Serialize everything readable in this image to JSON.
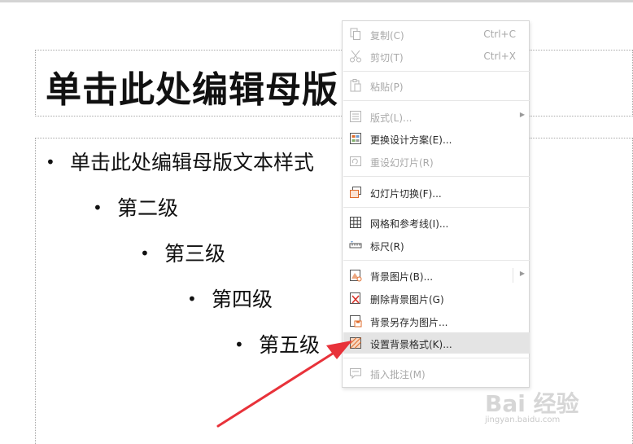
{
  "slide": {
    "title_placeholder": "单击此处编辑母版",
    "body_levels": [
      "单击此处编辑母版文本样式",
      "第二级",
      "第三级",
      "第四级",
      "第五级"
    ]
  },
  "context_menu": {
    "items": [
      {
        "label": "复制(C)",
        "shortcut": "Ctrl+C",
        "icon": "copy-icon",
        "disabled": true
      },
      {
        "label": "剪切(T)",
        "shortcut": "Ctrl+X",
        "icon": "cut-icon",
        "disabled": true
      },
      {
        "label": "粘贴(P)",
        "shortcut": "",
        "icon": "paste-icon",
        "disabled": true
      },
      {
        "label": "版式(L)...",
        "shortcut": "",
        "icon": "layout-icon",
        "disabled": true,
        "submenu": true
      },
      {
        "label": "更换设计方案(E)...",
        "shortcut": "",
        "icon": "design-scheme-icon",
        "disabled": false
      },
      {
        "label": "重设幻灯片(R)",
        "shortcut": "",
        "icon": "reset-slide-icon",
        "disabled": true
      },
      {
        "label": "幻灯片切换(F)...",
        "shortcut": "",
        "icon": "slide-transition-icon",
        "disabled": false
      },
      {
        "label": "网格和参考线(I)...",
        "shortcut": "",
        "icon": "grid-icon",
        "disabled": false
      },
      {
        "label": "标尺(R)",
        "shortcut": "",
        "icon": "ruler-icon",
        "disabled": false
      },
      {
        "label": "背景图片(B)...",
        "shortcut": "",
        "icon": "background-image-icon",
        "disabled": false,
        "submenu": true
      },
      {
        "label": "删除背景图片(G)",
        "shortcut": "",
        "icon": "delete-background-icon",
        "disabled": false
      },
      {
        "label": "背景另存为图片...",
        "shortcut": "",
        "icon": "save-background-icon",
        "disabled": false
      },
      {
        "label": "设置背景格式(K)...",
        "shortcut": "",
        "icon": "background-format-icon",
        "disabled": false,
        "highlighted": true
      },
      {
        "label": "插入批注(M)",
        "shortcut": "",
        "icon": "insert-comment-icon",
        "disabled": true
      }
    ]
  },
  "watermark": {
    "brand": "Bai 经验",
    "url": "jingyan.baidu.com"
  },
  "colors": {
    "annotation_arrow": "#e8323a",
    "menu_highlight": "#e4e4e4",
    "icon_accent": "#e06b2a"
  }
}
